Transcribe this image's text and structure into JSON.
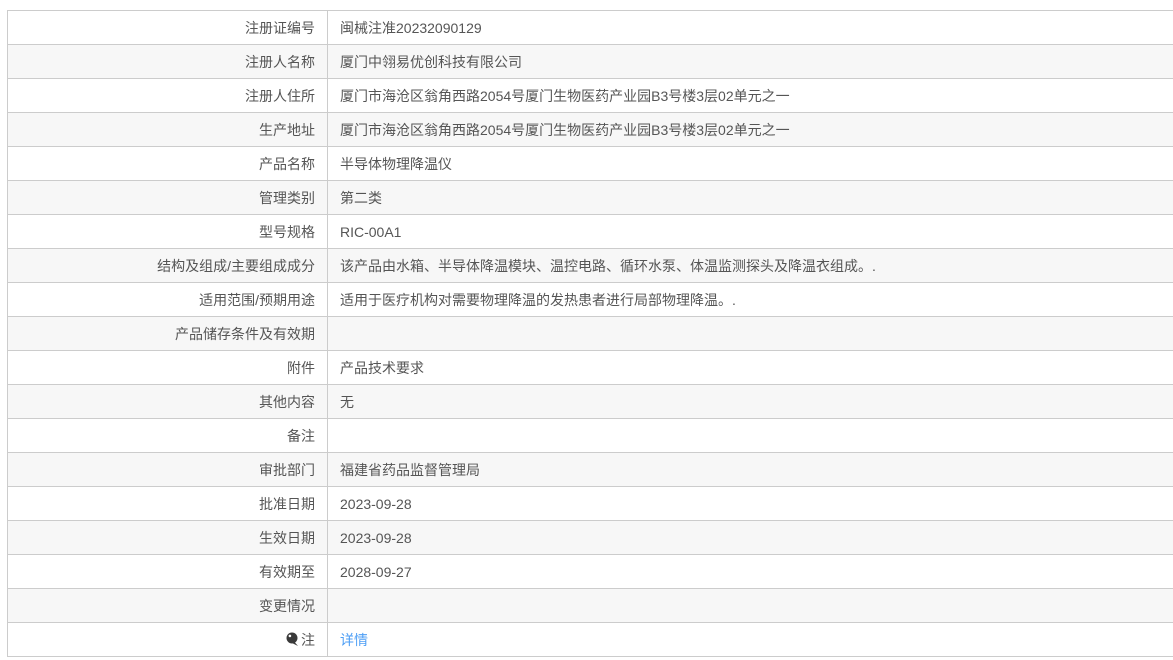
{
  "page": {
    "background_color": "#ffffff"
  },
  "table": {
    "border_color": "#cccccc",
    "stripe_color": "#f7f7f7",
    "text_color": "#555555",
    "link_color": "#4d9ef5",
    "rows": [
      {
        "label": "注册证编号",
        "value": "闽械注准20232090129"
      },
      {
        "label": "注册人名称",
        "value": "厦门中翎易优创科技有限公司"
      },
      {
        "label": "注册人住所",
        "value": "厦门市海沧区翁角西路2054号厦门生物医药产业园B3号楼3层02单元之一"
      },
      {
        "label": "生产地址",
        "value": "厦门市海沧区翁角西路2054号厦门生物医药产业园B3号楼3层02单元之一"
      },
      {
        "label": "产品名称",
        "value": "半导体物理降温仪"
      },
      {
        "label": "管理类别",
        "value": "第二类"
      },
      {
        "label": "型号规格",
        "value": "RIC-00A1"
      },
      {
        "label": "结构及组成/主要组成成分",
        "value": "该产品由水箱、半导体降温模块、温控电路、循环水泵、体温监测探头及降温衣组成。."
      },
      {
        "label": "适用范围/预期用途",
        "value": "适用于医疗机构对需要物理降温的发热患者进行局部物理降温。."
      },
      {
        "label": "产品储存条件及有效期",
        "value": ""
      },
      {
        "label": "附件",
        "value": "产品技术要求"
      },
      {
        "label": "其他内容",
        "value": "无"
      },
      {
        "label": "备注",
        "value": ""
      },
      {
        "label": "审批部门",
        "value": "福建省药品监督管理局"
      },
      {
        "label": "批准日期",
        "value": "2023-09-28"
      },
      {
        "label": "生效日期",
        "value": "2023-09-28"
      },
      {
        "label": "有效期至",
        "value": "2028-09-27"
      },
      {
        "label": "变更情况",
        "value": ""
      },
      {
        "label": "注",
        "value": "详情",
        "icon": "speech-balloon-icon",
        "value_is_link": true
      }
    ]
  }
}
